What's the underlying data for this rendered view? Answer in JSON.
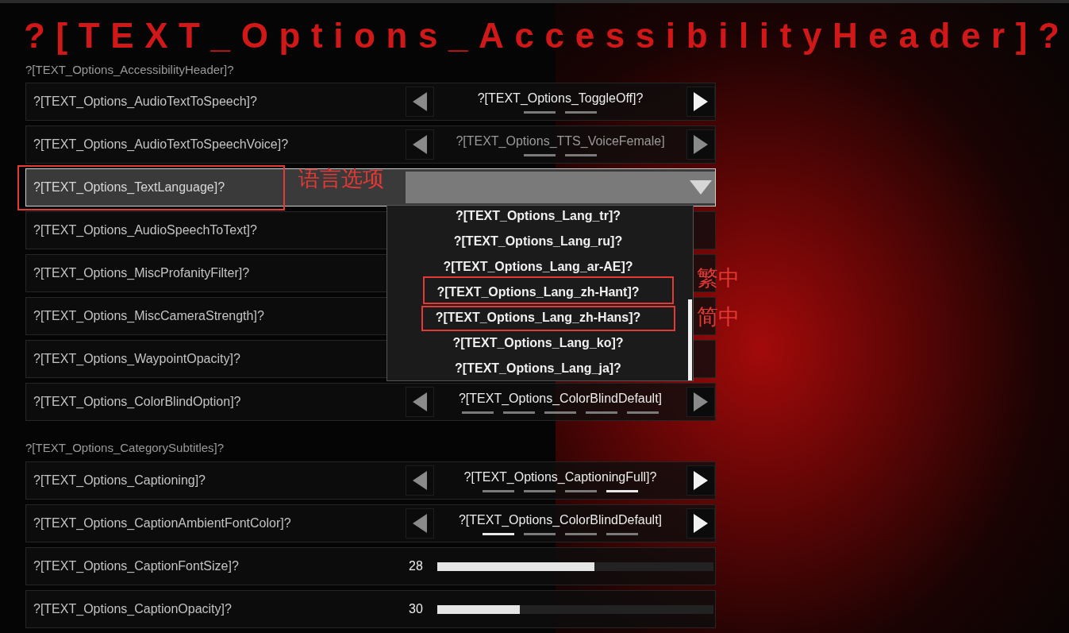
{
  "page_title": "?[TEXT_Options_AccessibilityHeader]?",
  "sections": [
    {
      "heading": "?[TEXT_Options_AccessibilityHeader]?",
      "rows": [
        {
          "label": "?[TEXT_Options_AudioTextToSpeech]?",
          "kind": "selector",
          "highlighted": false,
          "value": "?[TEXT_Options_ToggleOff]?",
          "value_dimmed": false,
          "prev_enabled": false,
          "next_enabled": true,
          "pips": [
            {
              "selected": false
            },
            {
              "selected": false
            }
          ]
        },
        {
          "label": "?[TEXT_Options_AudioTextToSpeechVoice]?",
          "kind": "selector",
          "highlighted": false,
          "value": "?[TEXT_Options_TTS_VoiceFemale]",
          "value_dimmed": true,
          "prev_enabled": false,
          "next_enabled": false,
          "pips": [
            {
              "selected": false
            },
            {
              "selected": false
            }
          ]
        },
        {
          "label": "?[TEXT_Options_TextLanguage]?",
          "kind": "dropdown",
          "highlighted": true,
          "expanded": true,
          "options": [
            {
              "label": "?[TEXT_Options_Lang_tr]?"
            },
            {
              "label": "?[TEXT_Options_Lang_ru]?"
            },
            {
              "label": "?[TEXT_Options_Lang_ar-AE]?"
            },
            {
              "label": "?[TEXT_Options_Lang_zh-Hant]?"
            },
            {
              "label": "?[TEXT_Options_Lang_zh-Hans]?"
            },
            {
              "label": "?[TEXT_Options_Lang_ko]?"
            },
            {
              "label": "?[TEXT_Options_Lang_ja]?"
            }
          ]
        },
        {
          "label": "?[TEXT_Options_AudioSpeechToText]?",
          "kind": "covered",
          "highlighted": false
        },
        {
          "label": "?[TEXT_Options_MiscProfanityFilter]?",
          "kind": "covered",
          "highlighted": false
        },
        {
          "label": "?[TEXT_Options_MiscCameraStrength]?",
          "kind": "covered",
          "highlighted": false
        },
        {
          "label": "?[TEXT_Options_WaypointOpacity]?",
          "kind": "covered",
          "highlighted": false
        },
        {
          "label": "?[TEXT_Options_ColorBlindOption]?",
          "kind": "selector",
          "highlighted": false,
          "value": "?[TEXT_Options_ColorBlindDefault]",
          "value_dimmed": false,
          "prev_enabled": false,
          "next_enabled": false,
          "pips": [
            {
              "selected": false
            },
            {
              "selected": false
            },
            {
              "selected": false
            },
            {
              "selected": false
            },
            {
              "selected": false
            }
          ]
        }
      ]
    },
    {
      "heading": "?[TEXT_Options_CategorySubtitles]?",
      "rows": [
        {
          "label": "?[TEXT_Options_Captioning]?",
          "kind": "selector",
          "highlighted": false,
          "value": "?[TEXT_Options_CaptioningFull]?",
          "value_dimmed": false,
          "prev_enabled": false,
          "next_enabled": true,
          "pips": [
            {
              "selected": false
            },
            {
              "selected": false
            },
            {
              "selected": false
            },
            {
              "selected": true
            }
          ]
        },
        {
          "label": "?[TEXT_Options_CaptionAmbientFontColor]?",
          "kind": "selector",
          "highlighted": false,
          "value": "?[TEXT_Options_ColorBlindDefault]",
          "value_dimmed": false,
          "prev_enabled": false,
          "next_enabled": true,
          "pips": [
            {
              "selected": true
            },
            {
              "selected": false
            },
            {
              "selected": false
            },
            {
              "selected": false
            }
          ]
        },
        {
          "label": "?[TEXT_Options_CaptionFontSize]?",
          "kind": "slider",
          "highlighted": false,
          "reading": "28",
          "level": 0.57
        },
        {
          "label": "?[TEXT_Options_CaptionOpacity]?",
          "kind": "slider",
          "highlighted": false,
          "reading": "30",
          "level": 0.3
        }
      ]
    }
  ],
  "annotations": [
    {
      "text": "语言选项"
    },
    {
      "text": "繁中"
    },
    {
      "text": "简中"
    }
  ]
}
